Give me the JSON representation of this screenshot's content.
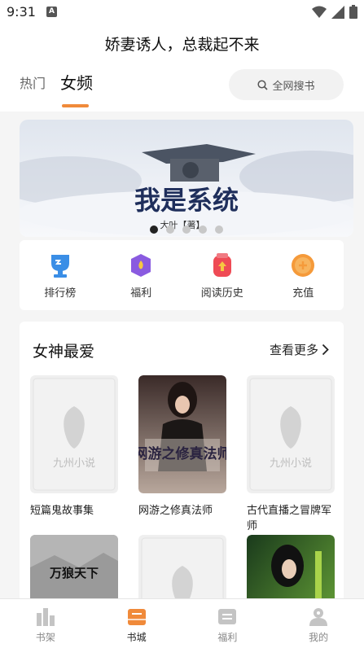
{
  "status_bar": {
    "time": "9:31",
    "notification_icon": "A"
  },
  "page": {
    "title": "娇妻诱人，总裁起不来"
  },
  "tabs": [
    {
      "label": "热门",
      "active": false
    },
    {
      "label": "女频",
      "active": true
    }
  ],
  "search": {
    "label": "全网搜书",
    "icon": "search-icon"
  },
  "banner": {
    "cover_title": "我是系统",
    "cover_subtitle": "大叶【著】",
    "slide_count": 5,
    "active_slide": 1
  },
  "quick_links": [
    {
      "label": "排行榜",
      "icon": "trophy-icon",
      "color": "#3a8ee6"
    },
    {
      "label": "福利",
      "icon": "gift-icon",
      "color": "#8a5be0"
    },
    {
      "label": "阅读历史",
      "icon": "history-icon",
      "color": "#ef4b55"
    },
    {
      "label": "充值",
      "icon": "coin-icon",
      "color": "#f59a3a"
    }
  ],
  "section": {
    "title": "女神最爱",
    "more_label": "查看更多",
    "placeholder_text": "九州小说",
    "books": [
      {
        "title": "短篇鬼故事集",
        "cover_type": "placeholder"
      },
      {
        "title": "网游之修真法师",
        "cover_type": "art",
        "cover_text": "网游之修真法师"
      },
      {
        "title": "古代直播之冒牌军师",
        "cover_type": "placeholder"
      },
      {
        "title": "",
        "cover_type": "art-dark",
        "cover_text": "万狼天下"
      },
      {
        "title": "",
        "cover_type": "placeholder"
      },
      {
        "title": "",
        "cover_type": "art-green"
      }
    ]
  },
  "bottom_nav": [
    {
      "label": "书架",
      "icon": "bookshelf-icon",
      "active": false
    },
    {
      "label": "书城",
      "icon": "bookstore-icon",
      "active": true
    },
    {
      "label": "福利",
      "icon": "welfare-icon",
      "active": false
    },
    {
      "label": "我的",
      "icon": "profile-icon",
      "active": false
    }
  ],
  "colors": {
    "accent": "#f08a3a",
    "background": "#f5f5f5"
  }
}
